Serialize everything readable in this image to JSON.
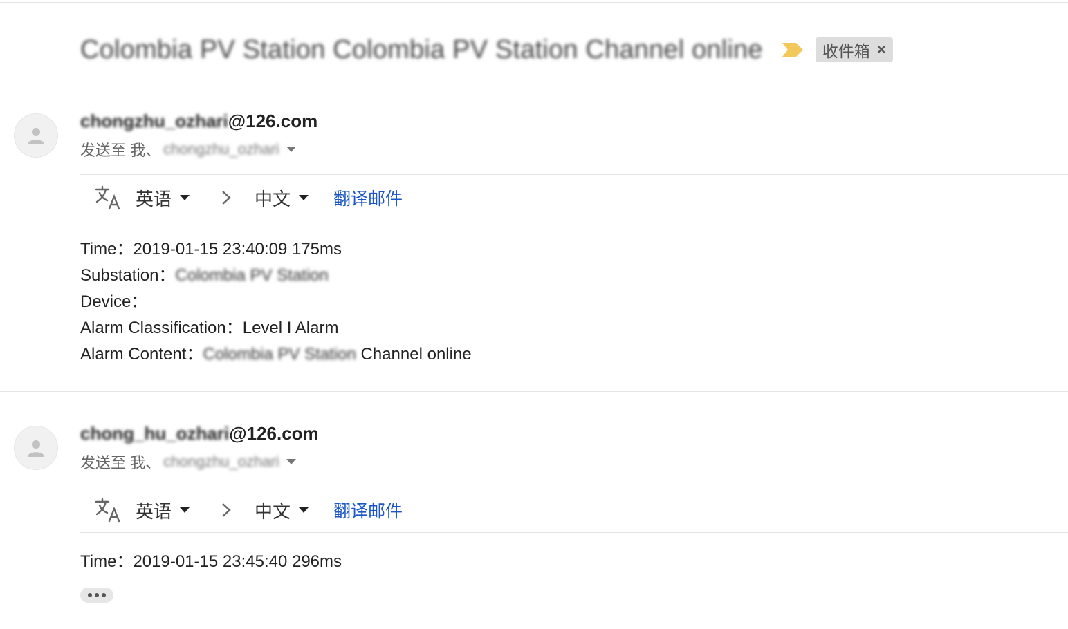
{
  "subject": {
    "text": "Colombia PV Station Colombia PV Station Channel online",
    "importance_icon": "importance-marker-icon",
    "importance_color": "#f2c85c"
  },
  "label_chip": {
    "text": "收件箱",
    "remove": "×"
  },
  "translate": {
    "source_lang": "英语",
    "target_lang": "中文",
    "action": "翻译邮件",
    "link_color": "#1a56c6"
  },
  "messages": [
    {
      "sender_hidden": "chongzhu_ozhari",
      "sender_domain": "@126.com",
      "to_prefix": "发送至 我、",
      "to_hidden": "chongzhu_ozhari",
      "body": {
        "time_label": "Time：",
        "time_value": "2019-01-15 23:40:09 175ms",
        "substation_label": "Substation：",
        "substation_value": "Colombia PV Station",
        "device_label": "Device：",
        "classification_label": "Alarm Classification：",
        "classification_value": "Level I Alarm",
        "content_label": "Alarm Content：",
        "content_hidden": "Colombia PV Station",
        "content_tail": " Channel online"
      }
    },
    {
      "sender_hidden": "chong_hu_ozhari",
      "sender_domain": "@126.com",
      "to_prefix": "发送至 我、",
      "to_hidden": "chongzhu_ozhari",
      "body": {
        "time_label": "Time：",
        "time_value": "2019-01-15 23:45:40 296ms"
      }
    }
  ]
}
